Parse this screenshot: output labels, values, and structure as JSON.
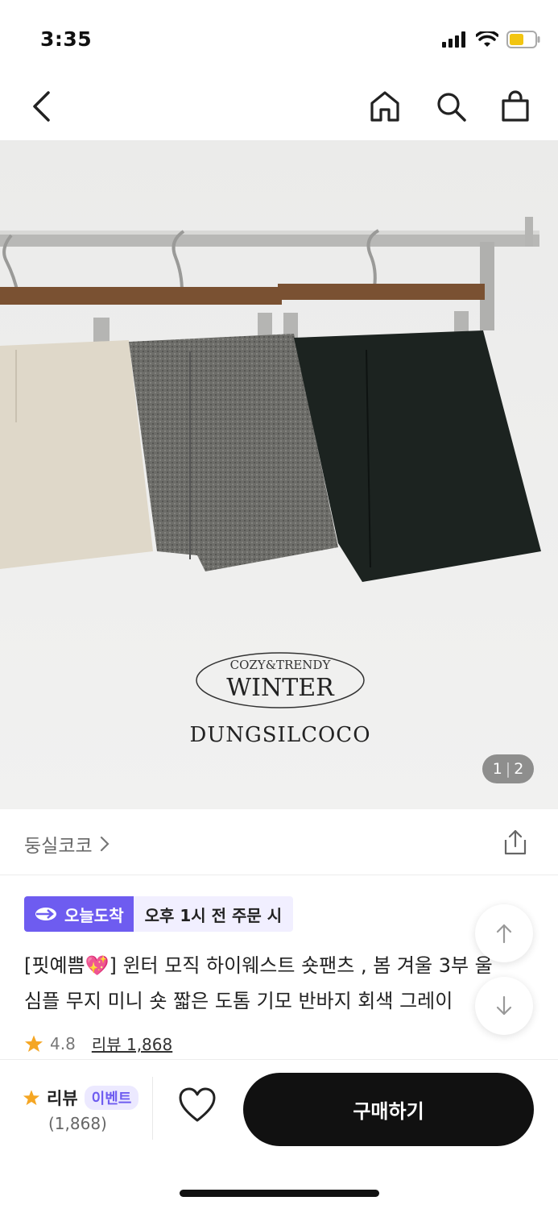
{
  "status": {
    "time": "3:35"
  },
  "hero": {
    "counter_current": "1",
    "counter_total": "2",
    "logo_top": "COZY&TRENDY",
    "logo_main": "WINTER",
    "brand_mark": "DUNGSILCOCO"
  },
  "store": {
    "name": "둥실코코"
  },
  "delivery": {
    "badge": "오늘도착",
    "text": "오후 1시 전 주문 시"
  },
  "product": {
    "title_line1": "[핏예쁨💖] 윈터 모직 하이웨스트 숏팬츠 , 봄 겨울 3부 울",
    "title_line2": "심플 무지 미니 숏 짧은 도톰 기모 반바지 회색 그레이",
    "rating": "4.8",
    "review_label": "리뷰 1,868"
  },
  "bottom": {
    "review_label": "리뷰",
    "event_label": "이벤트",
    "review_count": "(1,868)",
    "buy_label": "구매하기"
  },
  "colors": {
    "accent": "#6e5cf0",
    "star": "#f5a623",
    "buy_bg": "#111111"
  }
}
